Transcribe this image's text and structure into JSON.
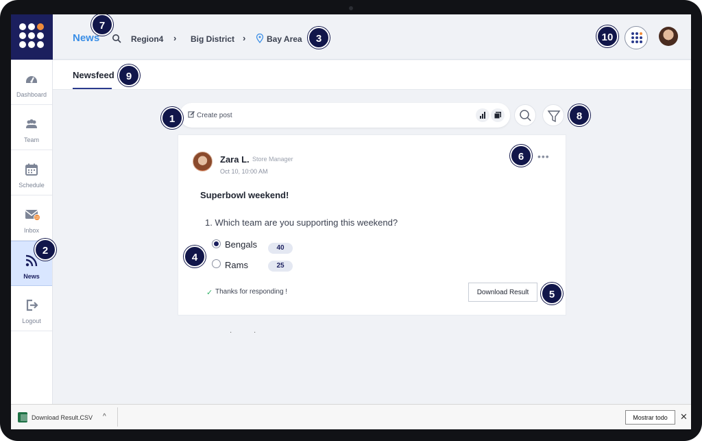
{
  "header": {
    "brand": "News",
    "breadcrumbs": [
      "Region4",
      "Big District",
      "Bay Area"
    ]
  },
  "sidebar": {
    "items": [
      {
        "label": "Dashboard",
        "icon": "dashboard-gauge-icon"
      },
      {
        "label": "Team",
        "icon": "team-icon"
      },
      {
        "label": "Schedule",
        "icon": "calendar-icon"
      },
      {
        "label": "Inbox",
        "icon": "mail-icon",
        "badge": "10"
      },
      {
        "label": "News",
        "icon": "rss-icon",
        "active": true
      },
      {
        "label": "Logout",
        "icon": "logout-icon"
      }
    ]
  },
  "tabs": [
    {
      "label": "Newsfeed",
      "active": true
    }
  ],
  "composer": {
    "placeholder": "Create post"
  },
  "post": {
    "author": "Zara L.",
    "role": "Store Manager",
    "timestamp": "Oct 10, 10:00 AM",
    "title": "Superbowl weekend!",
    "question": "1. Which team are you supporting this weekend?",
    "options": [
      {
        "label": "Bengals",
        "count": "40",
        "selected": true
      },
      {
        "label": "Rams",
        "count": "25",
        "selected": false
      }
    ],
    "confirmation": "Thanks for responding !",
    "download_label": "Download Result"
  },
  "markers": [
    "1",
    "2",
    "3",
    "4",
    "5",
    "6",
    "7",
    "8",
    "9",
    "10"
  ],
  "downloads_bar": {
    "file_name": "Download Result.CSV",
    "show_all_label": "Mostrar todo",
    "close_glyph": "✕"
  },
  "colors": {
    "brand_navy": "#1b1f5e",
    "accent_blue": "#3a8ee6",
    "accent_orange": "#f08c3a",
    "active_nav_bg": "#d9e6ff",
    "success_green": "#34b46a"
  }
}
